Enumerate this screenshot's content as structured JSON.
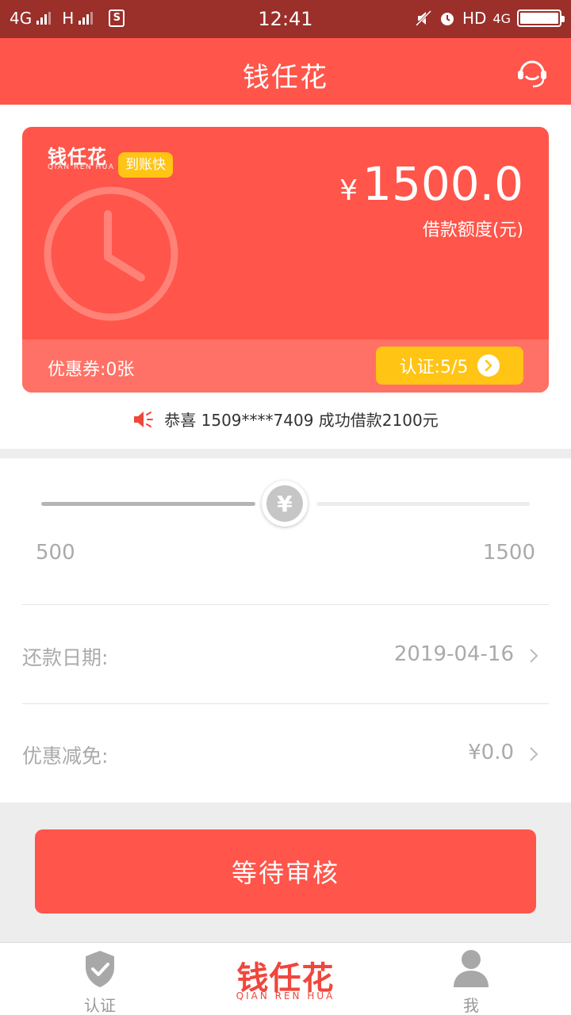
{
  "status_bar": {
    "network1": "4G",
    "network2": "H",
    "time": "12:41",
    "hd": "HD",
    "network3": "4G",
    "sim_label": "S"
  },
  "header": {
    "title": "钱任花",
    "service_icon": "customer-service-icon"
  },
  "card": {
    "logo_cn": "钱任花",
    "logo_en": "QIAN REN HUA",
    "badge": "到账快",
    "currency": "¥",
    "amount": "1500.0",
    "amount_label": "借款额度(元)",
    "coupon": "优惠券:0张",
    "verify": "认证:5/5",
    "colors": {
      "card_bg": "#ff554a",
      "footer_bg": "#ff7166",
      "accent": "#ffc414"
    }
  },
  "notice": {
    "icon": "speaker-icon",
    "text": "恭喜 1509****7409 成功借款2100元"
  },
  "slider": {
    "min": "500",
    "max": "1500",
    "thumb_symbol": "¥",
    "fraction": 0.5
  },
  "rows": [
    {
      "label": "还款日期:",
      "value": "2019-04-16"
    },
    {
      "label": "优惠减免:",
      "value": "¥0.0"
    }
  ],
  "action_button": {
    "label": "等待审核"
  },
  "bottom_nav": {
    "auth_label": "认证",
    "brand_cn": "钱任花",
    "brand_en": "QIAN REN HUA",
    "me_label": "我"
  }
}
